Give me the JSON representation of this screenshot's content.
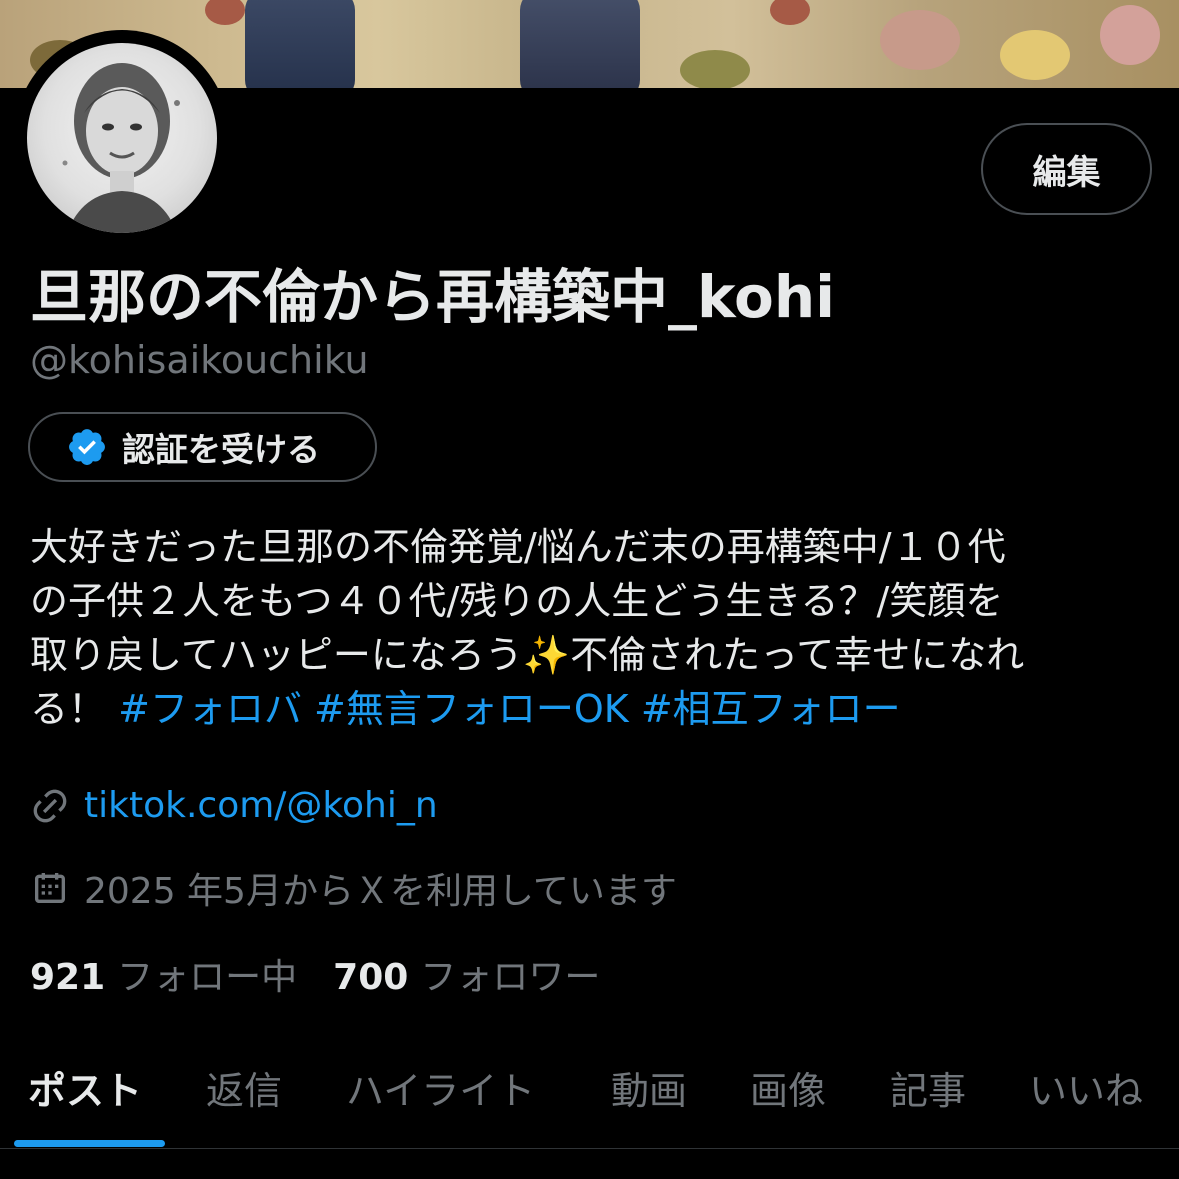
{
  "profile": {
    "display_name": "旦那の不倫から再構築中_kohi",
    "handle": "@kohisaikouchiku",
    "edit_label": "編集",
    "verify_label": "認証を受ける",
    "bio_lines": [
      "大好きだった旦那の不倫発覚/悩んだ末の再構築中/１０代",
      "の子供２人をもつ４０代/残りの人生どう生きる？/笑顔を",
      "取り戻してハッピーになろう✨不倫されたって幸せになれ"
    ],
    "bio_last_text": "る！",
    "hashtags": [
      "#フォロバ",
      "#無言フォローOK",
      "#相互フォロー"
    ],
    "link": "tiktok.com/@kohi_n",
    "joined": "2025 年5月からＸを利用しています",
    "following_count": "921",
    "following_label": "フォロー中",
    "followers_count": "700",
    "followers_label": "フォロワー"
  },
  "tabs": [
    {
      "label": "ポスト",
      "active": true
    },
    {
      "label": "返信",
      "active": false
    },
    {
      "label": "ハイライト",
      "active": false
    },
    {
      "label": "動画",
      "active": false
    },
    {
      "label": "画像",
      "active": false
    },
    {
      "label": "記事",
      "active": false
    },
    {
      "label": "いいね",
      "active": false
    }
  ],
  "colors": {
    "accent": "#1d9bf0",
    "background": "#000000",
    "text_primary": "#e7e9ea",
    "text_secondary": "#71767b"
  },
  "icons": {
    "verified": "verified-badge-icon",
    "link": "link-icon",
    "calendar": "calendar-icon"
  }
}
